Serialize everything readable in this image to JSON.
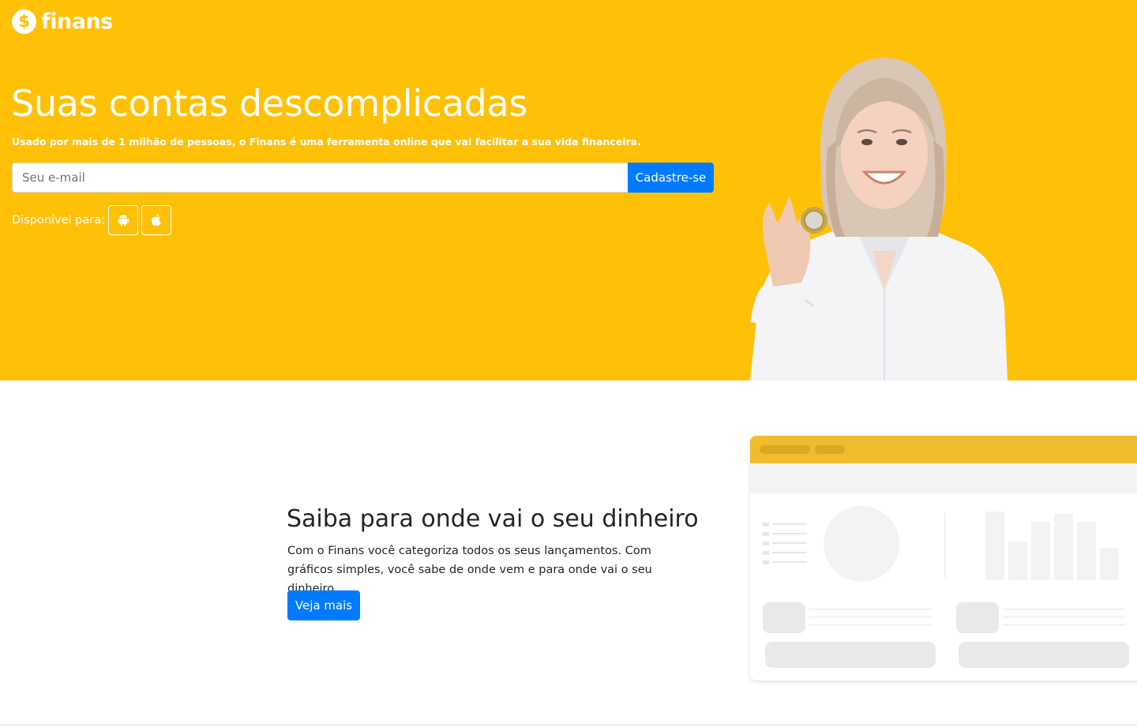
{
  "brand": {
    "name": "finans",
    "logo_symbol": "$"
  },
  "hero": {
    "title": "Suas contas descomplicadas",
    "subtitle": "Usado por mais de 1 milhão de pessoas, o Finans é uma ferramenta online que vai facilitar a sua vida financeira.",
    "email_placeholder": "Seu e-mail",
    "email_value": "",
    "signup_label": "Cadastre-se",
    "available_label": "Disponível para:",
    "platforms": [
      {
        "icon": "android-icon"
      },
      {
        "icon": "apple-icon"
      }
    ]
  },
  "feature": {
    "title": "Saiba para onde vai o seu dinheiro",
    "description": "Com o Finans você categoriza todos os seus lançamentos. Com gráficos simples, você sabe de onde vem e para onde vai o seu dinheiro.",
    "button_label": "Veja mais"
  },
  "colors": {
    "hero_background": "#ffc107",
    "primary": "#007bff",
    "mockup_header": "#f0bc2d",
    "text": "#212529"
  }
}
